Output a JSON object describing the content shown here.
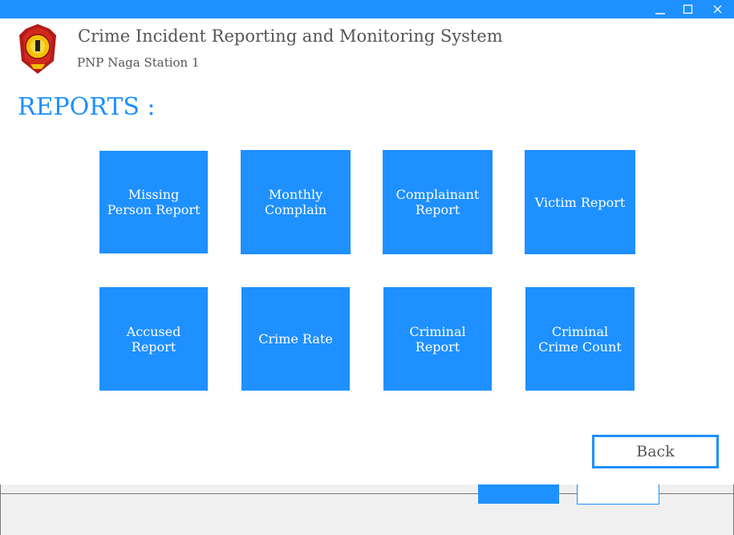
{
  "window": {
    "minimize_icon": "minimize-icon",
    "maximize_icon": "maximize-icon",
    "close_icon": "close-icon",
    "bar_color": "#1e90ff"
  },
  "header": {
    "logo_icon": "pnp-seal-logo",
    "title": "Crime Incident Reporting and Monitoring System",
    "subtitle": "PNP Naga Station 1"
  },
  "reports": {
    "heading": "REPORTS :",
    "tiles": [
      {
        "label": "Missing Person Report"
      },
      {
        "label": "Monthly Complain"
      },
      {
        "label": "Complainant Report"
      },
      {
        "label": "Victim Report"
      },
      {
        "label": "Accused Report"
      },
      {
        "label": "Crime Rate"
      },
      {
        "label": "Criminal Report"
      },
      {
        "label": "Criminal Crime Count"
      }
    ],
    "tile_color": "#1e90ff"
  },
  "actions": {
    "back_label": "Back"
  }
}
